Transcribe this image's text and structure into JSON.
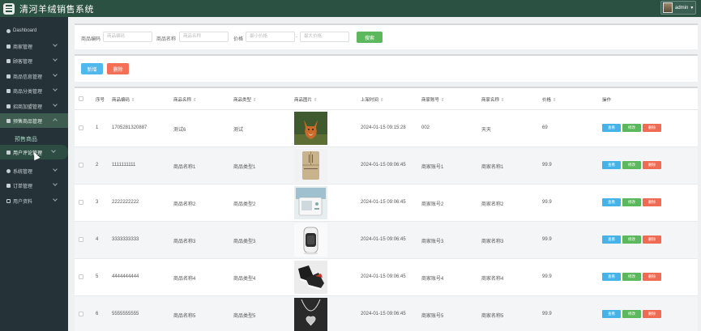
{
  "header": {
    "title": "清河羊绒销售系统",
    "user": "admin"
  },
  "sidebar": {
    "items": [
      {
        "label": "Dashboard",
        "icon": "dashboard-icon"
      },
      {
        "label": "商家管理",
        "icon": "store-icon"
      },
      {
        "label": "顾客管理",
        "icon": "user-icon"
      },
      {
        "label": "商品信息管理",
        "icon": "grid-icon"
      },
      {
        "label": "商品分类管理",
        "icon": "grid-icon"
      },
      {
        "label": "招商加盟管理",
        "icon": "grid-icon"
      },
      {
        "label": "预售商品管理",
        "icon": "grid-icon"
      },
      {
        "label": "用户评论管理",
        "icon": "comment-icon"
      },
      {
        "label": "系统管理",
        "icon": "gear-icon"
      },
      {
        "label": "订单管理",
        "icon": "cart-icon"
      },
      {
        "label": "用户资料",
        "icon": "profile-icon"
      }
    ],
    "sub_label": "预售商品"
  },
  "search": {
    "code_label": "商品编码",
    "code_placeholder": "商品编码",
    "name_label": "商品名称",
    "name_placeholder": "商品名称",
    "price_label": "价格",
    "min_placeholder": "最小价格",
    "dash": "-",
    "max_placeholder": "最大价格",
    "button": "搜索"
  },
  "actions": {
    "add": "新增",
    "delete": "删除"
  },
  "table": {
    "headers": [
      "序号",
      "商品编码",
      "商品名称",
      "商品类型",
      "商品图片",
      "上架时间",
      "商家账号",
      "商家名称",
      "价格",
      "操作"
    ],
    "ops": {
      "view": "查看",
      "edit": "修改",
      "delete": "删除"
    },
    "rows": [
      {
        "no": "1",
        "code": "1705281320887",
        "name": "测试6",
        "type": "测试",
        "image": "fox-photo",
        "time": "2024-01-15 09:15:28",
        "account": "002",
        "merchant": "天天",
        "price": "69"
      },
      {
        "no": "2",
        "code": "1111111111",
        "name": "商品名称1",
        "type": "商品类型1",
        "image": "refrigerator-photo",
        "time": "2024-01-15 09:06:45",
        "account": "商家账号1",
        "merchant": "商家名称1",
        "price": "99.9"
      },
      {
        "no": "3",
        "code": "2222222222",
        "name": "商品名称2",
        "type": "商品类型2",
        "image": "appliance-photo",
        "time": "2024-01-15 09:06:45",
        "account": "商家账号2",
        "merchant": "商家名称2",
        "price": "99.9"
      },
      {
        "no": "4",
        "code": "3333333333",
        "name": "商品名称3",
        "type": "商品类型3",
        "image": "heater-photo",
        "time": "2024-01-15 09:06:45",
        "account": "商家账号3",
        "merchant": "商家名称3",
        "price": "99.9"
      },
      {
        "no": "5",
        "code": "4444444444",
        "name": "商品名称4",
        "type": "商品类型4",
        "image": "shoes-photo",
        "time": "2024-01-15 09:06:45",
        "account": "商家账号4",
        "merchant": "商家名称4",
        "price": "99.9"
      },
      {
        "no": "6",
        "code": "5555555555",
        "name": "商品名称5",
        "type": "商品类型5",
        "image": "necklace-photo",
        "time": "2024-01-15 09:06:45",
        "account": "商家账号5",
        "merchant": "商家名称5",
        "price": "99.9"
      }
    ]
  }
}
